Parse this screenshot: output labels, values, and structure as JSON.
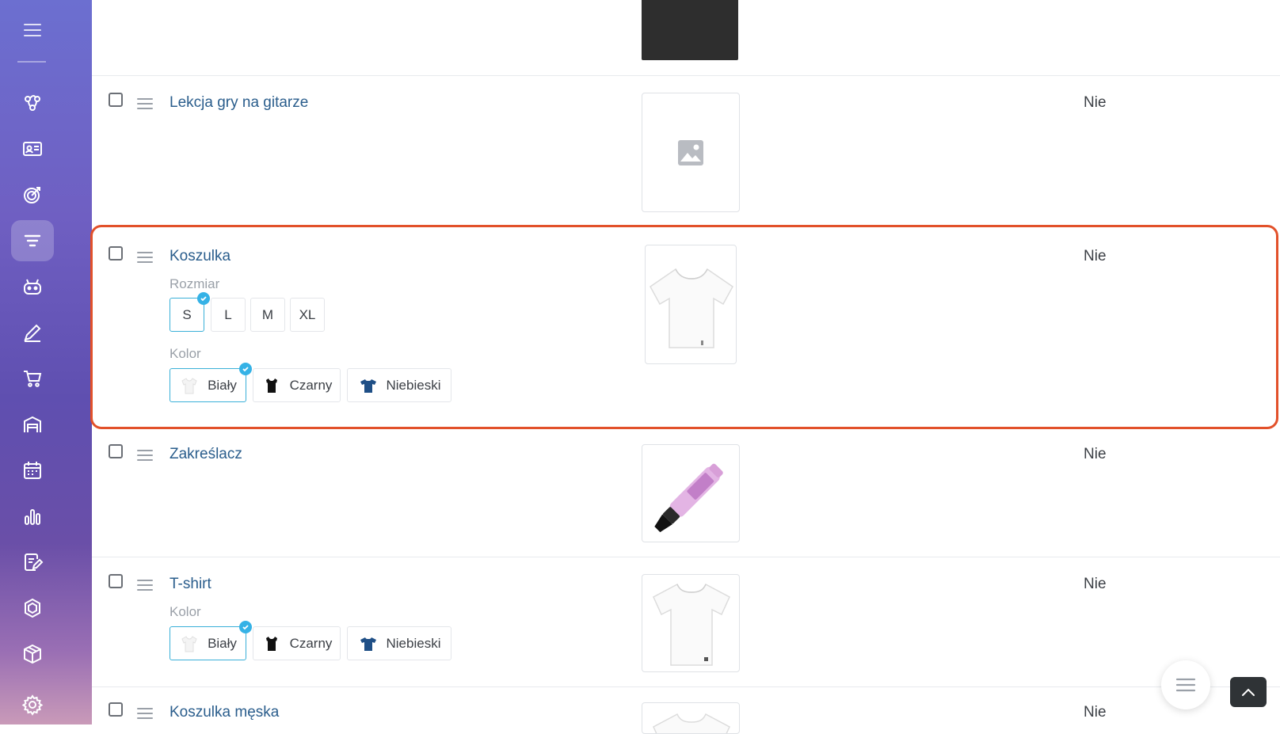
{
  "sidebar": {
    "items": [
      {
        "icon": "menu-icon"
      },
      {
        "icon": "crm-icon"
      },
      {
        "icon": "contacts-icon"
      },
      {
        "icon": "target-icon"
      },
      {
        "icon": "funnel-icon",
        "active": true
      },
      {
        "icon": "bot-icon"
      },
      {
        "icon": "edit-icon"
      },
      {
        "icon": "cart-icon"
      },
      {
        "icon": "warehouse-icon"
      },
      {
        "icon": "calendar-icon"
      },
      {
        "icon": "stats-icon"
      },
      {
        "icon": "documents-icon"
      },
      {
        "icon": "hexagon-icon"
      },
      {
        "icon": "box-icon"
      },
      {
        "icon": "settings-icon"
      }
    ]
  },
  "products": [
    {
      "name": "Lekcja gry na gitarze",
      "status": "Nie",
      "image": "placeholder-image"
    },
    {
      "name": "Koszulka",
      "status": "Nie",
      "image": "white-tshirt",
      "size_label": "Rozmiar",
      "sizes": [
        "S",
        "L",
        "M",
        "XL"
      ],
      "color_label": "Kolor",
      "colors": [
        "Biały",
        "Czarny",
        "Niebieski"
      ]
    },
    {
      "name": "Zakreślacz",
      "status": "Nie",
      "image": "highlighter"
    },
    {
      "name": "T-shirt",
      "status": "Nie",
      "image": "white-tshirt",
      "color_label": "Kolor",
      "colors": [
        "Biały",
        "Czarny",
        "Niebieski"
      ]
    },
    {
      "name": "Koszulka męska",
      "status": "Nie",
      "image": "white-tshirt"
    }
  ],
  "colors": {
    "accent": "#35b2e6",
    "highlight": "#e2512a",
    "link": "#2a5d8c",
    "navy_shirt": "#1f4f86"
  }
}
